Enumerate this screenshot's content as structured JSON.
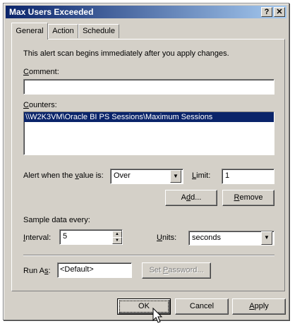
{
  "window": {
    "title": "Max Users Exceeded",
    "help_glyph": "?",
    "close_glyph": "✕"
  },
  "tabs": [
    {
      "label": "General"
    },
    {
      "label": "Action"
    },
    {
      "label": "Schedule"
    }
  ],
  "general": {
    "intro": "This alert scan begins immediately after you apply changes.",
    "comment": {
      "label_pre": "",
      "label_ul": "C",
      "label_post": "omment:",
      "value": ""
    },
    "counters": {
      "label_pre": "",
      "label_ul": "C",
      "label_post": "ounters:",
      "items": [
        "\\\\W2K3VM\\Oracle BI PS Sessions\\Maximum Sessions"
      ]
    },
    "alert": {
      "label_pre": "Alert when the ",
      "label_ul": "v",
      "label_post": "alue is:",
      "value": "Over",
      "limit_pre": "",
      "limit_ul": "L",
      "limit_post": "imit:",
      "limit_value": "1"
    },
    "add_button": {
      "pre": "A",
      "ul": "d",
      "post": "d..."
    },
    "remove_button": {
      "pre": "",
      "ul": "R",
      "post": "emove"
    },
    "sample": {
      "label": "Sample data every:",
      "interval_pre": "",
      "interval_ul": "I",
      "interval_post": "nterval:",
      "interval_value": "5",
      "units_pre": "",
      "units_ul": "U",
      "units_post": "nits:",
      "units_value": "seconds"
    },
    "run_as": {
      "label_pre": "Run A",
      "label_ul": "s",
      "label_post": ":",
      "value": "<Default>",
      "set_password": {
        "pre": "Set ",
        "ul": "P",
        "post": "assword..."
      }
    }
  },
  "footer": {
    "ok": "OK",
    "cancel": "Cancel",
    "apply_pre": "",
    "apply_ul": "A",
    "apply_post": "pply"
  }
}
